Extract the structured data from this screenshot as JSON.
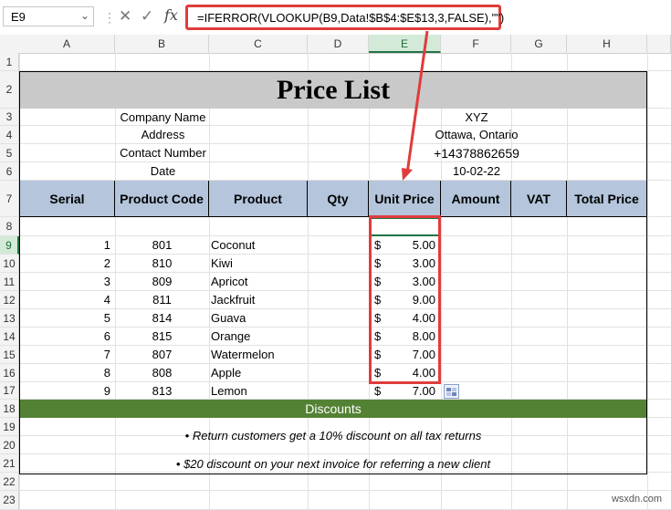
{
  "namebox": {
    "value": "E9"
  },
  "formula": {
    "text": "=IFERROR(VLOOKUP(B9,Data!$B$4:$E$13,3,FALSE),\"\")",
    "fx": "fx"
  },
  "columns": [
    "A",
    "B",
    "C",
    "D",
    "E",
    "F",
    "G",
    "H"
  ],
  "rows": [
    "1",
    "2",
    "3",
    "4",
    "5",
    "6",
    "7",
    "8",
    "9",
    "10",
    "11",
    "12",
    "13",
    "14",
    "15",
    "16",
    "17",
    "18",
    "19",
    "20",
    "21",
    "22",
    "23"
  ],
  "sheet": {
    "title": "Price List",
    "info_left": [
      "Company Name",
      "Address",
      "Contact Number",
      "Date"
    ],
    "info_right": [
      "XYZ",
      "Ottawa, Ontario",
      "+14378862659",
      "10-02-22"
    ],
    "headers": [
      "Serial",
      "Product Code",
      "Product",
      "Qty",
      "Unit Price",
      "Amount",
      "VAT",
      "Total Price"
    ],
    "items": [
      {
        "serial": "1",
        "code": "801",
        "product": "Coconut",
        "currency": "$",
        "price": "5.00"
      },
      {
        "serial": "2",
        "code": "810",
        "product": "Kiwi",
        "currency": "$",
        "price": "3.00"
      },
      {
        "serial": "3",
        "code": "809",
        "product": "Apricot",
        "currency": "$",
        "price": "3.00"
      },
      {
        "serial": "4",
        "code": "811",
        "product": "Jackfruit",
        "currency": "$",
        "price": "9.00"
      },
      {
        "serial": "5",
        "code": "814",
        "product": "Guava",
        "currency": "$",
        "price": "4.00"
      },
      {
        "serial": "6",
        "code": "815",
        "product": "Orange",
        "currency": "$",
        "price": "8.00"
      },
      {
        "serial": "7",
        "code": "807",
        "product": "Watermelon",
        "currency": "$",
        "price": "7.00"
      },
      {
        "serial": "8",
        "code": "808",
        "product": "Apple",
        "currency": "$",
        "price": "4.00"
      },
      {
        "serial": "9",
        "code": "813",
        "product": "Lemon",
        "currency": "$",
        "price": "7.00"
      }
    ],
    "discounts_title": "Discounts",
    "notes": [
      "• Return customers get a 10% discount on all tax returns",
      "• $20 discount on your next invoice for referring a new client"
    ]
  },
  "watermark": "wsxdn.com",
  "colors": {
    "accent": "#217346",
    "highlight": "#e03c3c",
    "header_fill": "#b4c5dc",
    "discount_fill": "#548235"
  }
}
